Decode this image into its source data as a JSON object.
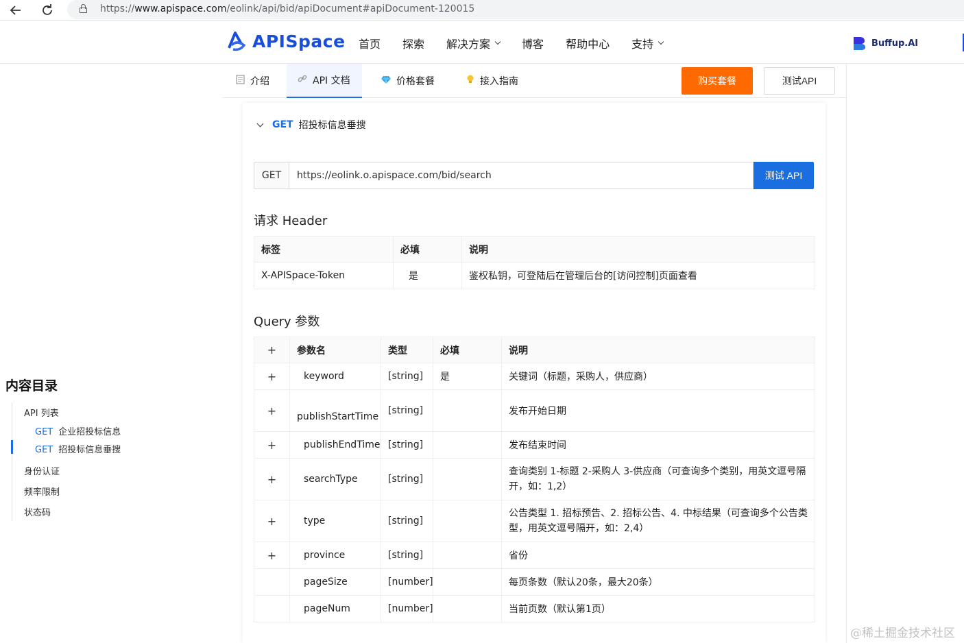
{
  "browser": {
    "url_scheme": "https://",
    "url_host": "www.apispace.com",
    "url_path": "/eolink/api/bid/apiDocument#apiDocument-120015"
  },
  "header": {
    "logo_text": "APISpace",
    "nav": [
      "首页",
      "探索",
      "解决方案",
      "博客",
      "帮助中心",
      "支持"
    ],
    "partner": "Buffup.AI",
    "brand_color": "#1b4ed8"
  },
  "tabs": [
    {
      "label": "介绍",
      "icon": "document-icon"
    },
    {
      "label": "API 文档",
      "icon": "link-icon"
    },
    {
      "label": "价格套餐",
      "icon": "diamond-icon"
    },
    {
      "label": "接入指南",
      "icon": "bulb-icon"
    }
  ],
  "actions": {
    "buy": "购买套餐",
    "test": "测试API"
  },
  "endpoint": {
    "method": "GET",
    "name": "招投标信息垂搜",
    "url": "https://eolink.o.apispace.com/bid/search",
    "send_label": "测试 API"
  },
  "request_header": {
    "title": "请求 Header",
    "columns": [
      "标签",
      "必填",
      "说明"
    ],
    "rows": [
      {
        "name": "X-APISpace-Token",
        "required": "是",
        "desc": "鉴权私钥，可登陆后在管理后台的[访问控制]页面查看"
      }
    ]
  },
  "query": {
    "title": "Query 参数",
    "plus": "+",
    "columns": [
      "参数名",
      "类型",
      "必填",
      "说明"
    ],
    "rows": [
      {
        "name": "keyword",
        "type": "[string]",
        "required": "是",
        "desc": "关键词（标题，采购人，供应商）"
      },
      {
        "name": "publishStartTime",
        "type": "[string]",
        "required": "",
        "desc": "发布开始日期"
      },
      {
        "name": "publishEndTime",
        "type": "[string]",
        "required": "",
        "desc": "发布结束时间"
      },
      {
        "name": "searchType",
        "type": "[string]",
        "required": "",
        "desc": "查询类别 1-标题 2-采购人 3-供应商（可查询多个类别，用英文逗号隔开，如：1,2）"
      },
      {
        "name": "type",
        "type": "[string]",
        "required": "",
        "desc": "公告类型 1. 招标预告、2. 招标公告、4. 中标结果（可查询多个公告类型，用英文逗号隔开，如：2,4）"
      },
      {
        "name": "province",
        "type": "[string]",
        "required": "",
        "desc": "省份"
      },
      {
        "name": "pageSize",
        "type": "[number]",
        "required": "",
        "desc": "每页条数（默认20条，最大20条）"
      },
      {
        "name": "pageNum",
        "type": "[number]",
        "required": "",
        "desc": "当前页数（默认第1页）"
      }
    ]
  },
  "toc": {
    "title": "内容目录",
    "api_list": "API 列表",
    "sub_items": [
      {
        "method": "GET",
        "label": "企业招投标信息"
      },
      {
        "method": "GET",
        "label": "招投标信息垂搜"
      }
    ],
    "items": [
      "身份认证",
      "频率限制",
      "状态码"
    ]
  },
  "watermark": "@稀土掘金技术社区"
}
